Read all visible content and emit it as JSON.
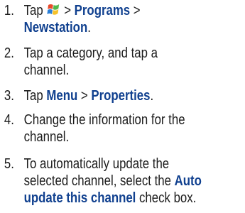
{
  "steps": [
    {
      "number": "1.",
      "tap": "Tap",
      "sep1": ">",
      "programs": "Programs",
      "sep2": ">",
      "newstation": "Newstation",
      "end": ".",
      "icon": "windows-start-icon"
    },
    {
      "number": "2.",
      "line1": "Tap a category, and tap a",
      "line2": "channel."
    },
    {
      "number": "3.",
      "tap": "Tap",
      "menu": "Menu",
      "sep": ">",
      "properties": "Properties",
      "end": "."
    },
    {
      "number": "4.",
      "line1": "Change the information for the",
      "line2": "channel."
    },
    {
      "number": "5.",
      "line1": "To automatically update the",
      "line2_text": "selected channel, select the",
      "auto": "Auto",
      "update_this_channel": "update this channel",
      "check_box": "check box."
    }
  ],
  "colors": {
    "text": "#1c1c1c",
    "highlight": "#10408f"
  }
}
